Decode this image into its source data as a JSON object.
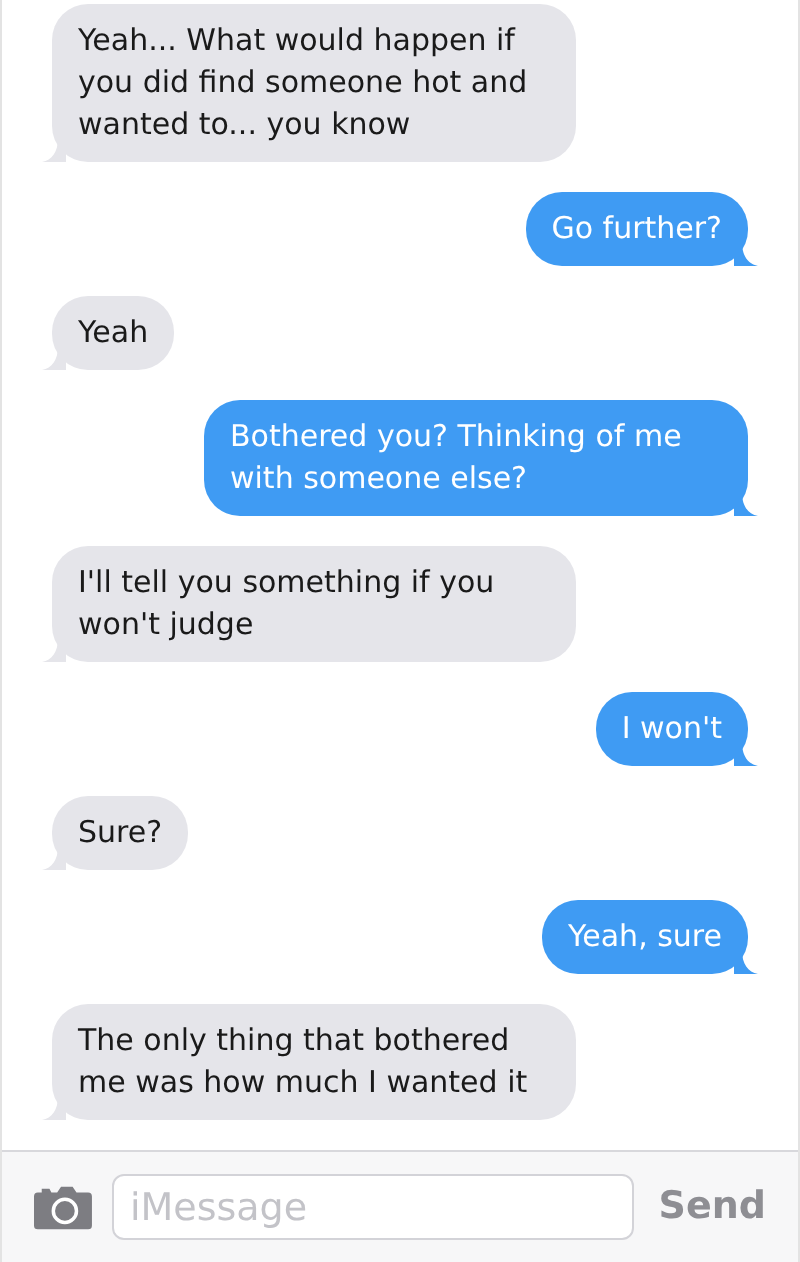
{
  "messages": [
    {
      "kind": "received",
      "text": "Yeah... What would happen if you did find someone hot and wanted to... you know"
    },
    {
      "kind": "sent",
      "text": "Go further?"
    },
    {
      "kind": "received",
      "text": "Yeah"
    },
    {
      "kind": "sent",
      "text": "Bothered you? Thinking of me with someone else?"
    },
    {
      "kind": "received",
      "text": "I'll tell you something if you won't judge"
    },
    {
      "kind": "sent",
      "text": "I won't"
    },
    {
      "kind": "received",
      "text": "Sure?"
    },
    {
      "kind": "sent",
      "text": "Yeah, sure"
    },
    {
      "kind": "received",
      "text": "The only thing that bothered me was how much I wanted it"
    }
  ],
  "composer": {
    "placeholder": "iMessage",
    "send": "Send"
  }
}
